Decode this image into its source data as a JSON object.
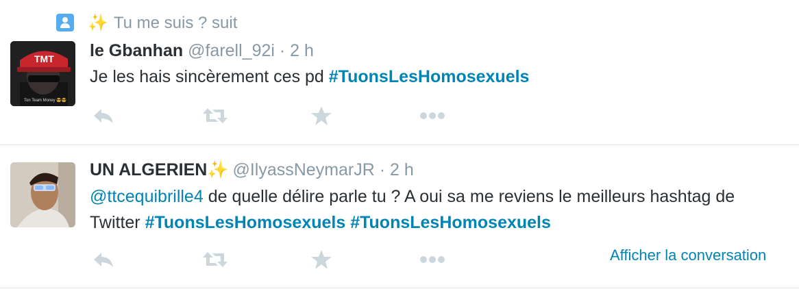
{
  "context": {
    "text": "Tu me suis ? suit",
    "icon": "user-icon",
    "sparkle": "✨"
  },
  "tweets": [
    {
      "name": "le Gbanhan",
      "handle": "@farell_92i",
      "dot": "·",
      "time": "2 h",
      "text_prefix": "Je les hais sincèrement ces pd ",
      "hashtag": "#TuonsLesHomosexuels",
      "avatar_text": "TMT",
      "avatar_caption": "Ton Team Money 😎😎",
      "actions": [
        "reply-icon",
        "retweet-icon",
        "favorite-icon",
        "more-icon"
      ]
    },
    {
      "name": "UN ALGERIEN",
      "name_sparkle": "✨",
      "handle": "@IlyassNeymarJR",
      "dot": "·",
      "time": "2 h",
      "mention": "@ttcequibrille4",
      "text_middle": " de quelle délire parle tu ? A oui sa me reviens le meilleurs hashtag de Twitter ",
      "hashtag1": "#TuonsLesHomosexuels",
      "hashtag2": "#TuonsLesHomosexuels",
      "show_conversation": "Afficher la conversation",
      "actions": [
        "reply-icon",
        "retweet-icon",
        "favorite-icon",
        "more-icon"
      ]
    }
  ],
  "colors": {
    "link": "#0084b4",
    "muted": "#8899a6",
    "icon": "#ccd6dd",
    "text": "#292f33",
    "divider": "#e1e8ed",
    "accent": "#55acee"
  }
}
